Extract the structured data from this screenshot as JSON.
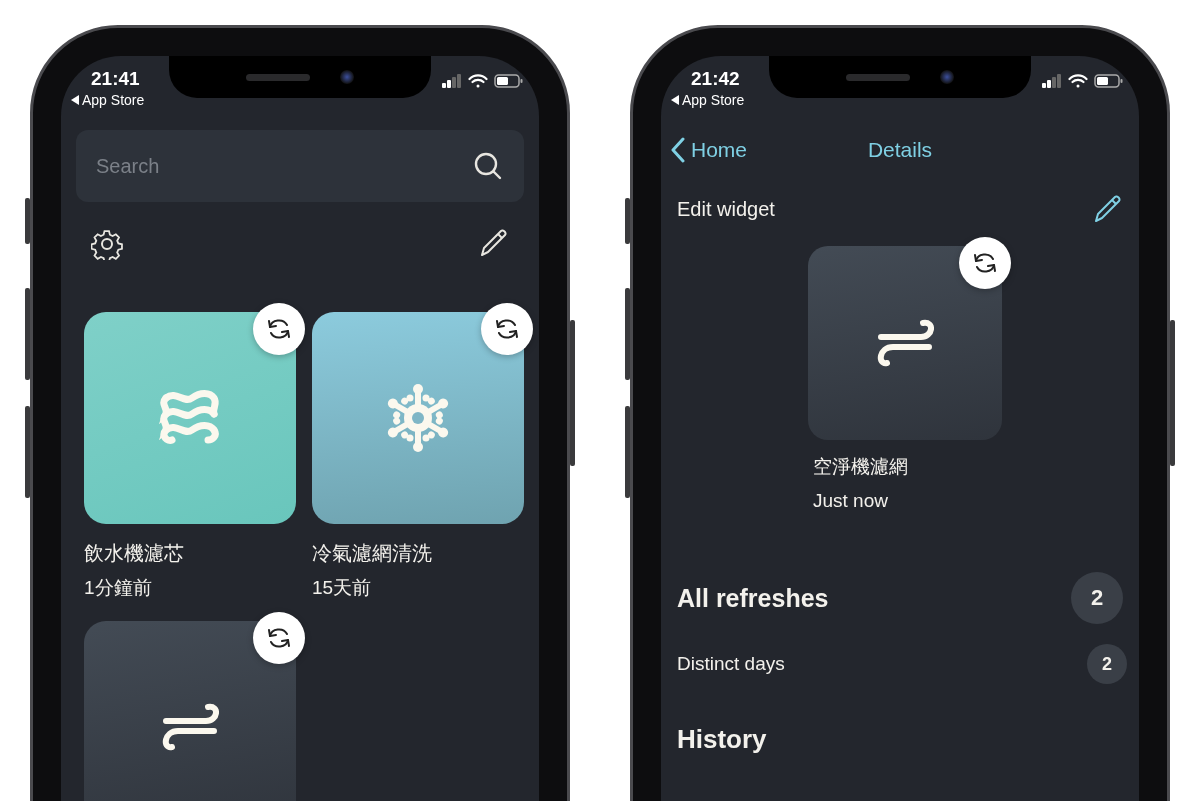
{
  "phones": [
    {
      "kind": "home",
      "status": {
        "time": "21:41",
        "back": "App Store"
      },
      "search": {
        "placeholder": "Search"
      },
      "tiles": [
        {
          "kind": "water",
          "name": "飲水機濾芯",
          "time": "1分鐘前"
        },
        {
          "kind": "aircon",
          "name": "冷氣濾網清洗",
          "time": "15天前"
        },
        {
          "kind": "air"
        }
      ]
    },
    {
      "kind": "details",
      "status": {
        "time": "21:42",
        "back": "App Store"
      },
      "nav": {
        "back": "Home",
        "title": "Details"
      },
      "edit_label": "Edit widget",
      "widget": {
        "kind": "air",
        "name": "空淨機濾網",
        "time": "Just now"
      },
      "stats": [
        {
          "kind": "major",
          "label": "All refreshes",
          "count": "2"
        },
        {
          "kind": "minor",
          "label": "Distinct days",
          "count": "2"
        }
      ],
      "section": "History"
    }
  ]
}
